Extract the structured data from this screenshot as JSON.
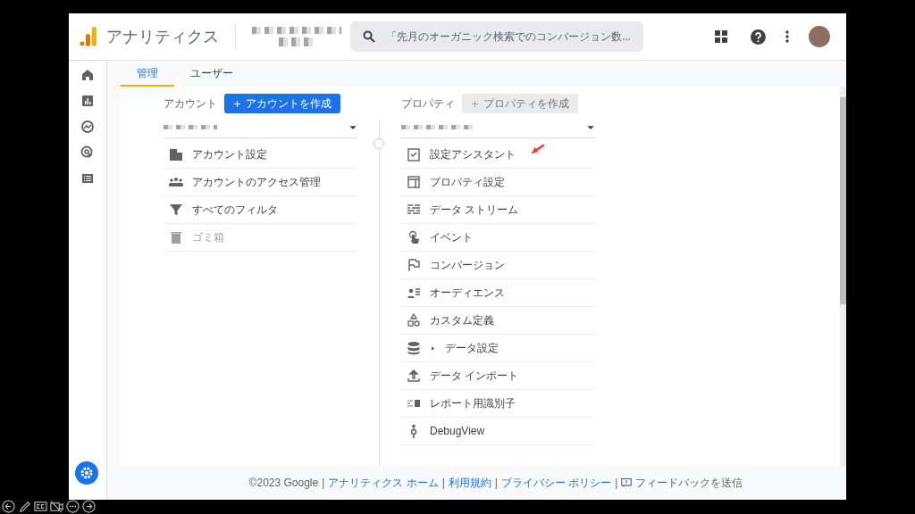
{
  "header": {
    "app_name": "アナリティクス",
    "search": {
      "placeholder": "「先月のオーガニック検索でのコンバージョン数..."
    }
  },
  "tabs": [
    {
      "label": "管理",
      "selected": true
    },
    {
      "label": "ユーザー",
      "selected": false
    }
  ],
  "account": {
    "label": "アカウント",
    "create_button": {
      "label": "アカウントを作成",
      "disabled": false
    },
    "items": [
      {
        "label": "アカウント設定",
        "disabled": false
      },
      {
        "label": "アカウントのアクセス管理",
        "disabled": false
      },
      {
        "label": "すべてのフィルタ",
        "disabled": false
      },
      {
        "label": "ゴミ箱",
        "disabled": true
      }
    ]
  },
  "property": {
    "label": "プロパティ",
    "create_button": {
      "label": "プロパティを作成",
      "disabled": true
    },
    "items": [
      {
        "label": "設定アシスタント",
        "disabled": false
      },
      {
        "label": "プロパティ設定",
        "disabled": false
      },
      {
        "label": "データ ストリーム",
        "disabled": false
      },
      {
        "label": "イベント",
        "disabled": false
      },
      {
        "label": "コンバージョン",
        "disabled": false
      },
      {
        "label": "オーディエンス",
        "disabled": false
      },
      {
        "label": "カスタム定義",
        "disabled": false
      },
      {
        "label": "データ設定",
        "disabled": false,
        "expanded": false
      },
      {
        "label": "データ インポート",
        "disabled": false
      },
      {
        "label": "レポート用識別子",
        "disabled": false
      },
      {
        "label": "DebugView",
        "disabled": false
      }
    ]
  },
  "footer": {
    "separator": "|",
    "items": [
      {
        "kind": "text",
        "text": "©2023 Google"
      },
      {
        "kind": "link",
        "text": "アナリティクス ホーム"
      },
      {
        "kind": "link",
        "text": "利用規約"
      },
      {
        "kind": "link",
        "text": "プライバシー ポリシー"
      },
      {
        "kind": "feedback",
        "text": "フィードバックを送信"
      }
    ]
  }
}
